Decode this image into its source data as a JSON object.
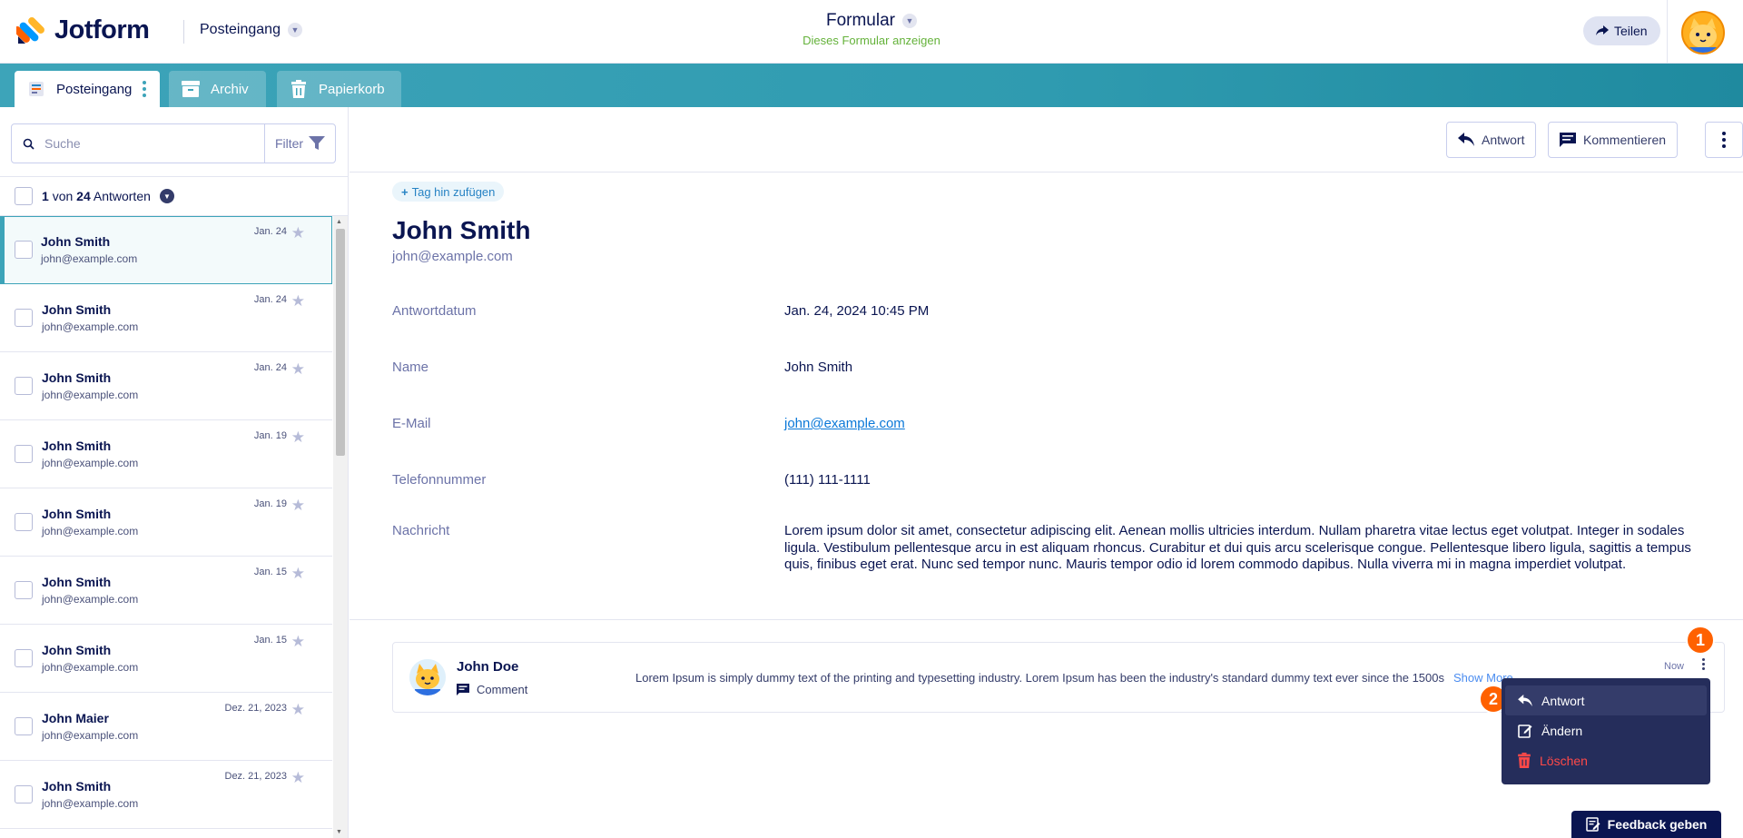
{
  "header": {
    "logo_text": "Jotform",
    "inbox_selector": "Posteingang",
    "form_title": "Formular",
    "form_subtitle": "Dieses Formular anzeigen",
    "share_label": "Teilen"
  },
  "tabs": [
    {
      "label": "Posteingang",
      "icon": "inbox-icon",
      "active": true
    },
    {
      "label": "Archiv",
      "icon": "archive-icon",
      "active": false
    },
    {
      "label": "Papierkorb",
      "icon": "trash-icon",
      "active": false
    }
  ],
  "sidebar": {
    "search_placeholder": "Suche",
    "filter_label": "Filter",
    "count": {
      "current": "1",
      "of_label": "von",
      "total": "24",
      "suffix": "Antworten"
    },
    "items": [
      {
        "name": "John Smith",
        "email": "john@example.com",
        "date": "Jan. 24"
      },
      {
        "name": "John Smith",
        "email": "john@example.com",
        "date": "Jan. 24"
      },
      {
        "name": "John Smith",
        "email": "john@example.com",
        "date": "Jan. 24"
      },
      {
        "name": "John Smith",
        "email": "john@example.com",
        "date": "Jan. 19"
      },
      {
        "name": "John Smith",
        "email": "john@example.com",
        "date": "Jan. 19"
      },
      {
        "name": "John Smith",
        "email": "john@example.com",
        "date": "Jan. 15"
      },
      {
        "name": "John Smith",
        "email": "john@example.com",
        "date": "Jan. 15"
      },
      {
        "name": "John Maier",
        "email": "john@example.com",
        "date": "Dez. 21, 2023"
      },
      {
        "name": "John Smith",
        "email": "john@example.com",
        "date": "Dez. 21, 2023"
      }
    ]
  },
  "toolbar": {
    "reply_label": "Antwort",
    "comment_label": "Kommentieren"
  },
  "submission": {
    "tag_add_label": "Tag hin zufügen",
    "name": "John Smith",
    "email": "john@example.com",
    "fields": [
      {
        "label": "Antwortdatum",
        "value": "Jan. 24, 2024 10:45 PM"
      },
      {
        "label": "Name",
        "value": "John Smith"
      },
      {
        "label": "E-Mail",
        "value": "john@example.com"
      },
      {
        "label": "Telefonnummer",
        "value": "(111) 111-1111"
      },
      {
        "label": "Nachricht",
        "value": "Lorem ipsum dolor sit amet, consectetur adipiscing elit. Aenean mollis ultricies interdum. Nullam pharetra vitae lectus eget volutpat. Integer in sodales ligula. Vestibulum pellentesque arcu in est aliquam rhoncus. Curabitur et dui quis arcu scelerisque congue. Pellentesque libero ligula, sagittis a tempus quis, finibus eget erat. Nunc sed tempor nunc. Mauris tempor odio id lorem commodo dapibus. Nulla viverra mi in magna imperdiet volutpat."
      }
    ]
  },
  "comment": {
    "author": "John Doe",
    "type": "Comment",
    "text": "Lorem Ipsum is simply dummy text of the printing and typesetting industry. Lorem Ipsum has been the industry's standard dummy text ever since the 1500s",
    "show_more": "Show More",
    "time": "Now"
  },
  "context_menu": {
    "items": [
      {
        "label": "Antwort",
        "icon": "reply-icon"
      },
      {
        "label": "Ändern",
        "icon": "edit-icon"
      },
      {
        "label": "Löschen",
        "icon": "trash-icon"
      }
    ]
  },
  "badges": [
    "1",
    "2"
  ],
  "feedback_label": "Feedback geben",
  "colors": {
    "navy": "#0a1551",
    "teal": "#3da4b9",
    "orange": "#ff6100",
    "danger": "#ff4948",
    "menu_bg": "#252d5b",
    "green_link": "#64b23a"
  }
}
